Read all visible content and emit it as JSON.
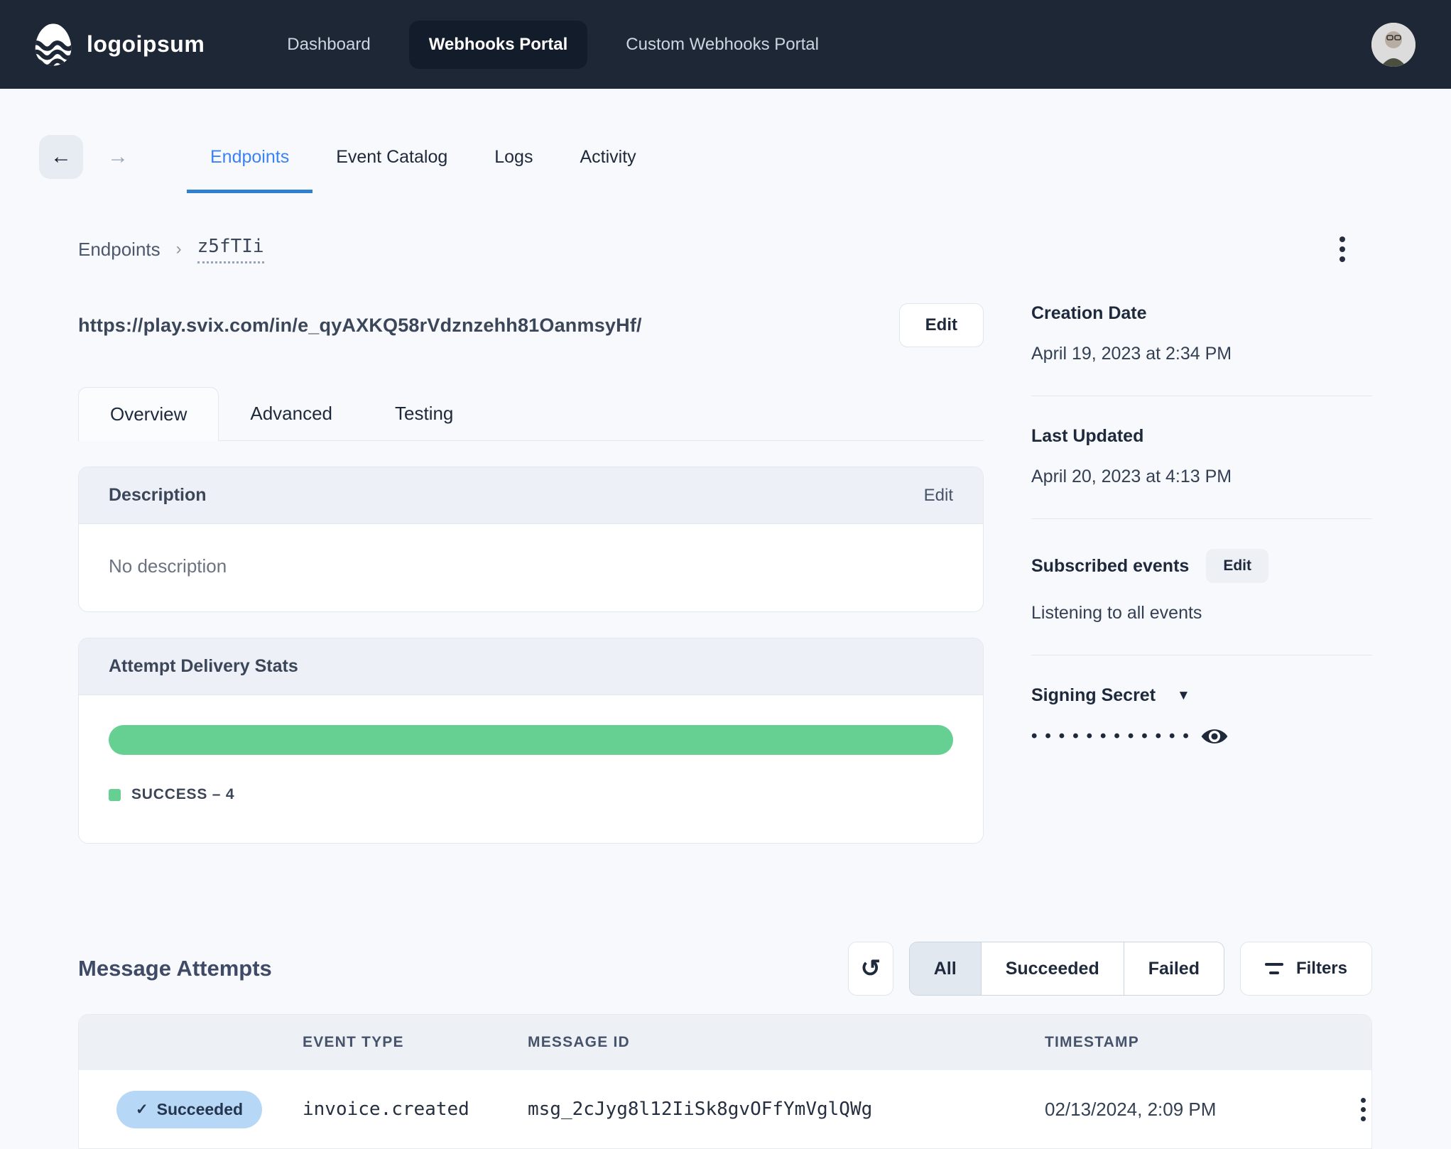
{
  "colors": {
    "nav_bg": "#1e2736",
    "nav_active_bg": "#131c2b",
    "accent_blue": "#3b82f6",
    "success_green": "#65d092",
    "badge_blue_bg": "#b7d7f6",
    "page_bg": "#f7f9fc"
  },
  "icons": {
    "back_arrow": "←",
    "forward_arrow": "→",
    "breadcrumb_chevron": "›",
    "dropdown_caret": "▼",
    "refresh": "↺",
    "check": "✓"
  },
  "nav": {
    "logo_text": "logoipsum",
    "items": [
      {
        "label": "Dashboard",
        "active": false
      },
      {
        "label": "Webhooks Portal",
        "active": true
      },
      {
        "label": "Custom Webhooks Portal",
        "active": false
      }
    ]
  },
  "top_tabs": {
    "items": [
      {
        "label": "Endpoints",
        "active": true
      },
      {
        "label": "Event Catalog",
        "active": false
      },
      {
        "label": "Logs",
        "active": false
      },
      {
        "label": "Activity",
        "active": false
      }
    ]
  },
  "breadcrumb": {
    "root": "Endpoints",
    "current": "z5fTIi"
  },
  "endpoint": {
    "url": "https://play.svix.com/in/e_qyAXKQ58rVdznzehh81OanmsyHf/",
    "edit_label": "Edit",
    "detail_tabs": [
      {
        "label": "Overview",
        "active": true
      },
      {
        "label": "Advanced",
        "active": false
      },
      {
        "label": "Testing",
        "active": false
      }
    ],
    "description": {
      "title": "Description",
      "edit_label": "Edit",
      "empty_text": "No description"
    },
    "delivery_stats": {
      "title": "Attempt Delivery Stats",
      "legend_label": "SUCCESS – 4",
      "series": [
        {
          "name": "SUCCESS",
          "value": 4,
          "share": 1.0,
          "color": "#65d092"
        }
      ]
    }
  },
  "sidebar": {
    "creation_date": {
      "label": "Creation Date",
      "value": "April 19, 2023 at 2:34 PM"
    },
    "last_updated": {
      "label": "Last Updated",
      "value": "April 20, 2023 at 4:13 PM"
    },
    "subscribed_events": {
      "label": "Subscribed events",
      "edit_label": "Edit",
      "value": "Listening to all events"
    },
    "signing_secret": {
      "label": "Signing Secret",
      "masked_value": "••••••••••••"
    }
  },
  "attempts": {
    "title": "Message Attempts",
    "filter_tabs": [
      {
        "label": "All",
        "active": true
      },
      {
        "label": "Succeeded",
        "active": false
      },
      {
        "label": "Failed",
        "active": false
      }
    ],
    "filters_label": "Filters",
    "table": {
      "columns": {
        "event_type": "EVENT TYPE",
        "message_id": "MESSAGE ID",
        "timestamp": "TIMESTAMP"
      },
      "rows": [
        {
          "status": "Succeeded",
          "event_type": "invoice.created",
          "message_id": "msg_2cJyg8l12IiSk8gvOFfYmVglQWg",
          "timestamp": "02/13/2024, 2:09 PM"
        }
      ]
    }
  }
}
